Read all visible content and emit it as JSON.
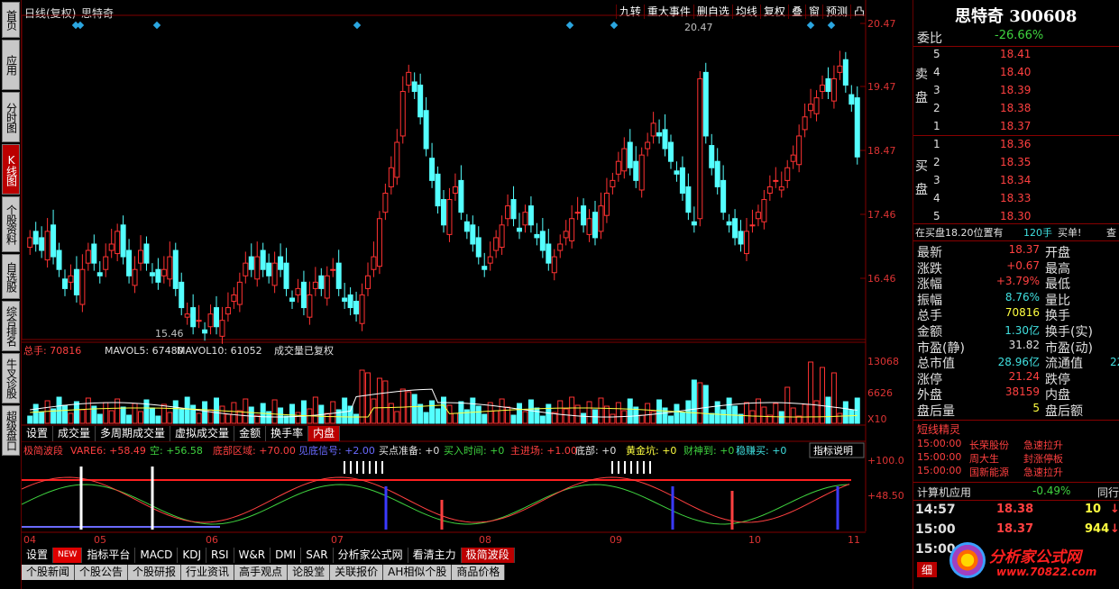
{
  "left_tabs": [
    "首页",
    "应用",
    "分时图",
    "K线图",
    "个股资料",
    "自选股",
    "综合排名",
    "牛叉诊股",
    "超级盘口"
  ],
  "active_left_tab": 3,
  "header": {
    "title": "日线(复权)",
    "stock": "思特奇"
  },
  "toolbar": [
    "九转",
    "重大事件",
    "删自选",
    "均线",
    "复权",
    "叠",
    "窗",
    "预测",
    "凸"
  ],
  "price_axis": [
    "20.47",
    "19.47",
    "18.47",
    "17.46",
    "16.46"
  ],
  "high_label": "20.47",
  "low_label": "15.46",
  "volume_header": {
    "total": "总手: 70816",
    "mavol5": "MAVOL5: 67480",
    "mavol10": "MAVOL10: 61052",
    "note": "成交量已复权"
  },
  "volume_axis": [
    "13068",
    "6626",
    "X10"
  ],
  "sub_tabs": [
    "设置",
    "成交量",
    "多周期成交量",
    "虚拟成交量",
    "金额",
    "换手率",
    "内盘"
  ],
  "sub_tabs_active": 6,
  "indicator_header": {
    "name": "极简波段",
    "vare6": "VARE6: +58.49",
    "kong": "空: +56.58",
    "dibu": "底部区域: +70.00",
    "jiandi": "见底信号: +2.00",
    "maidian": "买点准备: +0",
    "mairu": "买入时间: +0",
    "zhujin": "主进场: +1.00",
    "dibu2": "底部: +0",
    "huangjin": "黄金坑: +0",
    "caishen": "财神到: +0",
    "wenzhuan": "稳赚买: +0",
    "explain": "指标说明"
  },
  "indicator_axis": [
    "+100.0",
    "+48.50"
  ],
  "months": [
    "04",
    "05",
    "06",
    "07",
    "08",
    "09",
    "10",
    "11"
  ],
  "bottom_tabs": [
    "设置",
    "NEW",
    "指标平台",
    "MACD",
    "KDJ",
    "RSI",
    "W&R",
    "DMI",
    "SAR",
    "分析家公式网",
    "看清主力",
    "极简波段"
  ],
  "bottom_tabs2": [
    "个股新闻",
    "个股公告",
    "个股研报",
    "行业资讯",
    "高手观点",
    "论股堂",
    "关联报价",
    "AH相似个股",
    "商品价格"
  ],
  "right": {
    "stock_name": "思特奇",
    "stock_code": "300608",
    "weibi_label": "委比",
    "weibi": "-26.66%",
    "sell": [
      {
        "n": "5",
        "p": "18.41"
      },
      {
        "n": "4",
        "p": "18.40"
      },
      {
        "n": "3",
        "p": "18.39"
      },
      {
        "n": "2",
        "p": "18.38"
      },
      {
        "n": "1",
        "p": "18.37"
      }
    ],
    "buy": [
      {
        "n": "1",
        "p": "18.36"
      },
      {
        "n": "2",
        "p": "18.35"
      },
      {
        "n": "3",
        "p": "18.34"
      },
      {
        "n": "4",
        "p": "18.33"
      },
      {
        "n": "5",
        "p": "18.30"
      }
    ],
    "sell_label": "卖盘",
    "buy_label": "买盘",
    "status": "在买盘18.20位置有",
    "status2": "120手",
    "status3": "买单!",
    "status4": "查",
    "quotes": [
      {
        "l": "最新",
        "v": "18.37",
        "r": "开盘",
        "c": "red"
      },
      {
        "l": "涨跌",
        "v": "+0.67",
        "r": "最高",
        "c": "red"
      },
      {
        "l": "涨幅",
        "v": "+3.79%",
        "r": "最低",
        "c": "red"
      },
      {
        "l": "振幅",
        "v": "8.76%",
        "r": "量比",
        "c": "cyan"
      },
      {
        "l": "总手",
        "v": "70816",
        "r": "换手",
        "c": "yel"
      },
      {
        "l": "金额",
        "v": "1.30亿",
        "r": "换手(实)",
        "c": "cyan"
      },
      {
        "l": "市盈(静)",
        "v": "31.82",
        "r": "市盈(动)",
        "c": "white"
      },
      {
        "l": "总市值",
        "v": "28.96亿",
        "r": "流通值",
        "c": "cyan"
      },
      {
        "l": "涨停",
        "v": "21.24",
        "r": "跌停",
        "c": "red"
      },
      {
        "l": "外盘",
        "v": "38159",
        "r": "内盘",
        "c": "red"
      },
      {
        "l": "盘后量",
        "v": "5",
        "r": "盘后额",
        "c": "yel"
      }
    ],
    "liutong_val": "22",
    "duanxian_title": "短线精灵",
    "duanxian": [
      {
        "t": "15:00:00",
        "n": "长荣股份",
        "a": "急速拉升"
      },
      {
        "t": "15:00:00",
        "n": "周大生",
        "a": "封涨停板"
      },
      {
        "t": "15:00:00",
        "n": "国新能源",
        "a": "急速拉升"
      }
    ],
    "sector": "计算机应用",
    "sector_chg": "-0.49%",
    "sector_btn": "同行",
    "ticks": [
      {
        "t": "14:57",
        "p": "18.38",
        "v": "10",
        "d": "↓"
      },
      {
        "t": "15:00",
        "p": "18.37",
        "v": "944",
        "d": "↓"
      },
      {
        "t": "15:00",
        "p": "",
        "v": "",
        "d": ""
      }
    ],
    "watermark": "分析家公式网",
    "watermark_url": "www.70822.com",
    "detail_tab": "细"
  }
}
